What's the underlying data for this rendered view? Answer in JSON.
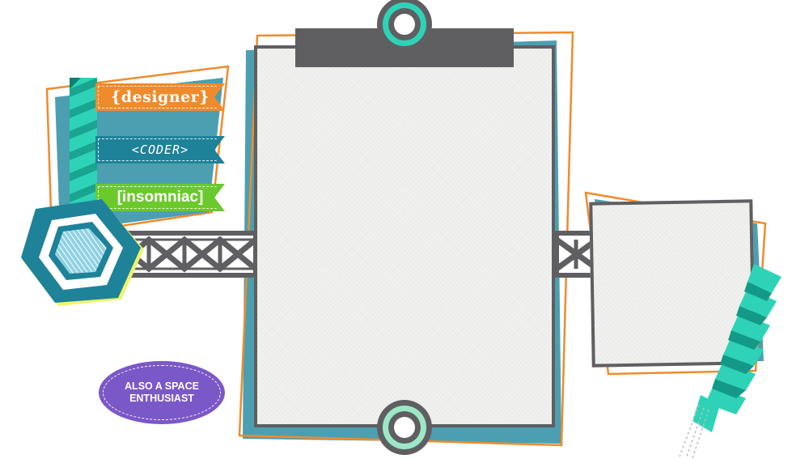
{
  "labels": {
    "designer": "{designer}",
    "coder": "<CODER>",
    "insomniac": "[insomniac]",
    "badge": "ALSO A SPACE ENTHUSIAST"
  },
  "colors": {
    "orange": "#ef8b2c",
    "teal": "#1e8299",
    "mint": "#2ed3b7",
    "green": "#6cc92c",
    "purple": "#7b58c7",
    "gray": "#5f5f62",
    "paper": "#f1f1f0",
    "slate": "#4c9fb0"
  },
  "icons": [
    "hexagon-emblem-icon",
    "binder-ring-icon",
    "truss-bridge-icon",
    "ribbon-banner-icon"
  ]
}
